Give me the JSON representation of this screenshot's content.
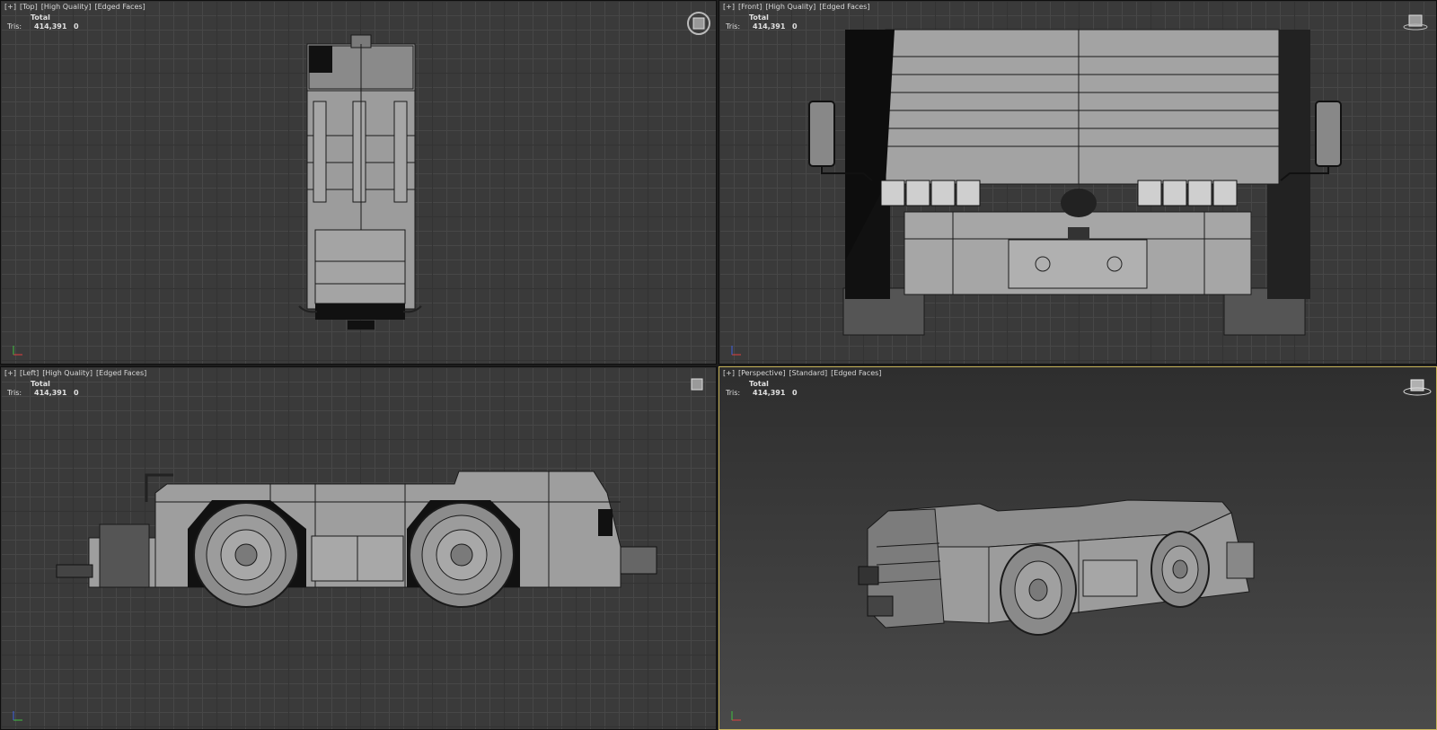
{
  "viewports": [
    {
      "id": "top",
      "labels": [
        "[+]",
        "[Top]",
        "[High Quality]",
        "[Edged Faces]"
      ]
    },
    {
      "id": "front",
      "labels": [
        "[+]",
        "[Front]",
        "[High Quality]",
        "[Edged Faces]"
      ]
    },
    {
      "id": "left",
      "labels": [
        "[+]",
        "[Left]",
        "[High Quality]",
        "[Edged Faces]"
      ]
    },
    {
      "id": "persp",
      "labels": [
        "[+]",
        "[Perspective]",
        "[Standard]",
        "[Edged Faces]"
      ]
    }
  ],
  "stats": {
    "header": "Total",
    "key": "Tris:",
    "total": "414,391",
    "selected": "0"
  },
  "colors": {
    "active_border": "#c8b45a",
    "grid": "#3a3a3a",
    "model": "#9a9a9a"
  }
}
